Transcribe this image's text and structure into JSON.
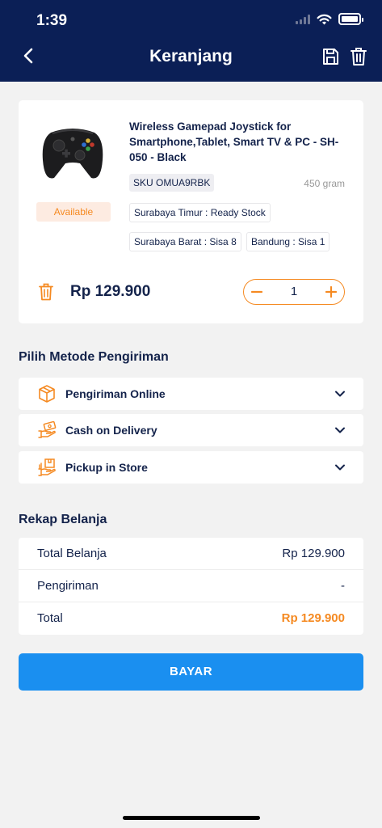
{
  "status_bar": {
    "time": "1:39"
  },
  "header": {
    "title": "Keranjang"
  },
  "product": {
    "availability": "Available",
    "name": "Wireless Gamepad Joystick for Smartphone,Tablet, Smart TV & PC - SH-050 - Black",
    "sku": "SKU OMUA9RBK",
    "weight": "450 gram",
    "stock": [
      "Surabaya Timur : Ready Stock",
      "Surabaya Barat : Sisa 8",
      "Bandung : Sisa 1"
    ],
    "price": "Rp 129.900",
    "quantity": "1"
  },
  "shipping": {
    "title": "Pilih Metode Pengiriman",
    "options": [
      {
        "label": "Pengiriman Online",
        "icon": "package-icon"
      },
      {
        "label": "Cash on Delivery",
        "icon": "cash-hand-icon"
      },
      {
        "label": "Pickup in Store",
        "icon": "pickup-store-icon"
      }
    ]
  },
  "recap": {
    "title": "Rekap Belanja",
    "rows": [
      {
        "label": "Total Belanja",
        "value": "Rp 129.900"
      },
      {
        "label": "Pengiriman",
        "value": "-"
      },
      {
        "label": "Total",
        "value": "Rp 129.900"
      }
    ]
  },
  "pay_button": {
    "label": "BAYAR"
  },
  "colors": {
    "header_bg": "#0b1f56",
    "accent": "#f58a22",
    "primary_button": "#1a8ff0",
    "text": "#14234b"
  }
}
